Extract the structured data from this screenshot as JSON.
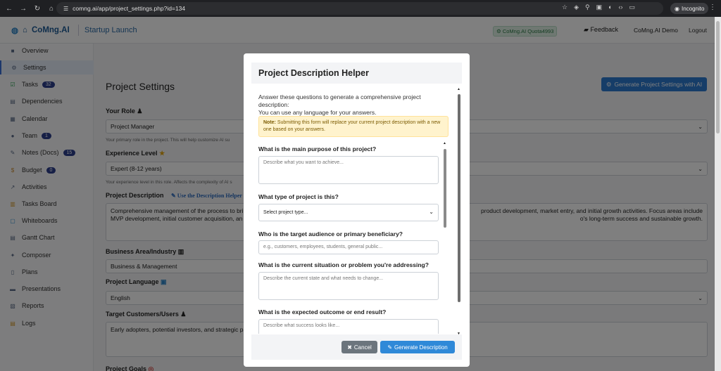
{
  "browser": {
    "url": "comng.ai/app/project_settings.php?id=134",
    "incognito_label": "Incognito"
  },
  "topnav": {
    "brand": "CoMng.AI",
    "project_name": "Startup Launch",
    "quota": "CoMng.AI Quota4993",
    "feedback": "Feedback",
    "user": "CoMng.AI Demo",
    "logout": "Logout"
  },
  "sidebar": {
    "items": [
      {
        "label": "Overview",
        "icon": "briefcase-icon",
        "badge": ""
      },
      {
        "label": "Settings",
        "icon": "gear-icon",
        "badge": ""
      },
      {
        "label": "Tasks",
        "icon": "check-square-icon",
        "badge": "32"
      },
      {
        "label": "Dependencies",
        "icon": "dependencies-icon",
        "badge": ""
      },
      {
        "label": "Calendar",
        "icon": "calendar-icon",
        "badge": ""
      },
      {
        "label": "Team",
        "icon": "team-icon",
        "badge": "1"
      },
      {
        "label": "Notes (Docs)",
        "icon": "notes-icon",
        "badge": "15"
      },
      {
        "label": "Budget",
        "icon": "money-bag-icon",
        "badge": "0"
      },
      {
        "label": "Activities",
        "icon": "chart-icon",
        "badge": ""
      },
      {
        "label": "Tasks Board",
        "icon": "board-icon",
        "badge": ""
      },
      {
        "label": "Whiteboards",
        "icon": "whiteboard-icon",
        "badge": ""
      },
      {
        "label": "Gantt Chart",
        "icon": "gantt-icon",
        "badge": ""
      },
      {
        "label": "Composer",
        "icon": "composer-icon",
        "badge": ""
      },
      {
        "label": "Plans",
        "icon": "plans-icon",
        "badge": ""
      },
      {
        "label": "Presentations",
        "icon": "presentation-icon",
        "badge": ""
      },
      {
        "label": "Reports",
        "icon": "reports-icon",
        "badge": ""
      },
      {
        "label": "Logs",
        "icon": "logs-icon",
        "badge": ""
      }
    ]
  },
  "main": {
    "title": "Project Settings",
    "generate_button": "Generate Project Settings with AI",
    "your_role": {
      "label": "Your Role",
      "value": "Project Manager",
      "help": "Your primary role in the project. This will help customize AI su"
    },
    "experience": {
      "label": "Experience Level",
      "value": "Expert (8-12 years)",
      "help": "Your experience level in this role. Affects the complexity of AI s"
    },
    "description": {
      "label": "Project Description",
      "helper_link": "Use the Description Helper",
      "line1_left": "Comprehensive management of the process to bri",
      "line1_right": "product development, market entry, and initial growth activities. Focus areas include",
      "line2_left": "MVP development, initial customer acquisition, an",
      "line2_right": "o's long-term success and sustainable growth."
    },
    "business_area": {
      "label": "Business Area/Industry",
      "value": "Business & Management"
    },
    "language": {
      "label": "Project Language",
      "value": "English"
    },
    "target_customers": {
      "label": "Target Customers/Users",
      "value": "Early adopters, potential investors, and strategic pa"
    },
    "goals_label": "Project Goals"
  },
  "modal": {
    "title": "Project Description Helper",
    "intro_line1": "Answer these questions to generate a comprehensive project",
    "intro_line2": "description:",
    "intro_line3": "You can use any language for your answers.",
    "note_label": "Note:",
    "note_text": "Submitting this form will replace your current project description with a new one based on your answers.",
    "questions": [
      {
        "label": "What is the main purpose of this project?",
        "placeholder": "Describe what you want to achieve..."
      },
      {
        "label": "What type of project is this?",
        "placeholder": "Select project type..."
      },
      {
        "label": "Who is the target audience or primary beneficiary?",
        "placeholder": "e.g., customers, employees, students, general public..."
      },
      {
        "label": "What is the current situation or problem you're addressing?",
        "placeholder": "Describe the current state and what needs to change..."
      },
      {
        "label": "What is the expected outcome or end result?",
        "placeholder": "Describe what success looks like..."
      }
    ],
    "cancel": "Cancel",
    "generate": "Generate Description"
  },
  "colors": {
    "primary": "#2c7ad0",
    "brand": "#1d5b96",
    "note_bg": "#fff3cd",
    "cancel_bg": "#6c757d"
  }
}
